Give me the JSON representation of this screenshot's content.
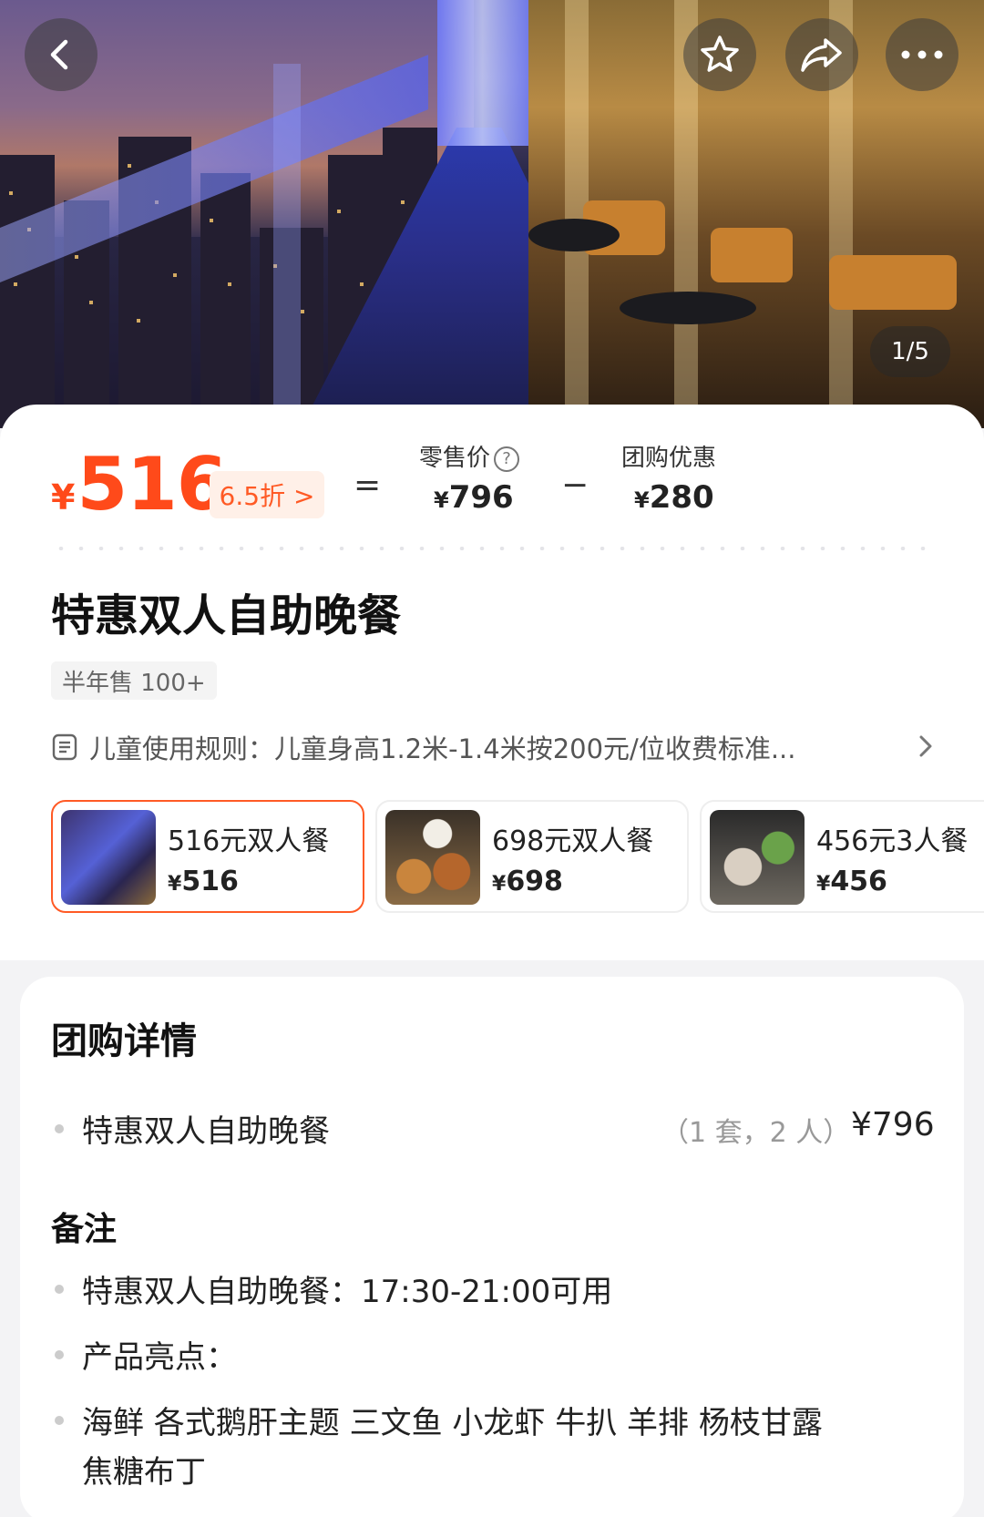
{
  "hero": {
    "image_counter": "1/5",
    "back_icon": "chevron-left-icon",
    "fav_icon": "star-icon",
    "share_icon": "share-icon",
    "more_icon": "more-dots-icon"
  },
  "price": {
    "currency": "¥",
    "current": "516",
    "discount_label": "6.5折 >",
    "equals": "=",
    "minus": "−",
    "retail_label": "零售价",
    "retail_value": "796",
    "group_label": "团购优惠",
    "group_value": "280",
    "accent_color": "#ff4a1a"
  },
  "deal": {
    "title": "特惠双人自助晚餐",
    "sold": "半年售 100+",
    "child_rule": "儿童使用规则：儿童身高1.2米-1.4米按200元/位收费标准..."
  },
  "packages": [
    {
      "name": "516元双人餐",
      "price": "516",
      "selected": true
    },
    {
      "name": "698元双人餐",
      "price": "698",
      "selected": false
    },
    {
      "name": "456元3人餐",
      "price": "456",
      "selected": false
    }
  ],
  "details": {
    "section_title": "团购详情",
    "item_name": "特惠双人自助晚餐",
    "item_qty": "（1 套，2 人）",
    "item_price": "¥796",
    "notes_title": "备注",
    "notes": [
      "特惠双人自助晚餐：17:30-21:00可用",
      "产品亮点：",
      "海鲜 各式鹅肝主题 三文鱼 小龙虾 牛扒 羊排 杨枝甘露",
      "焦糖布丁"
    ]
  }
}
